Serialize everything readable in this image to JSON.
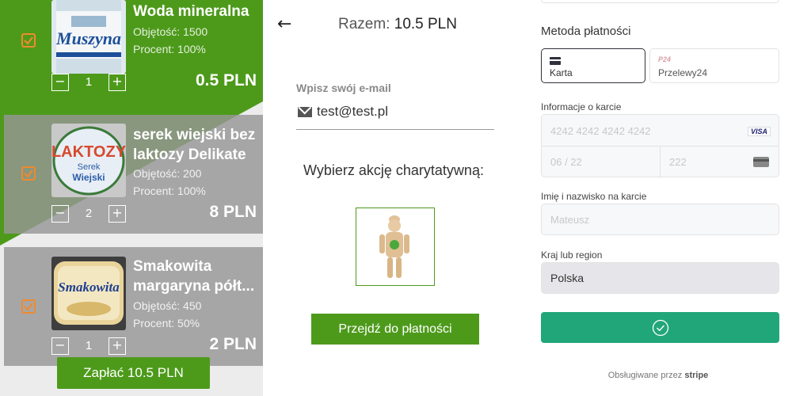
{
  "cart": {
    "items": [
      {
        "name": "Woda mineralna",
        "volume": "Objętość: 1500",
        "percent": "Procent: 100%",
        "qty": "1",
        "price": "0.5 PLN",
        "image": "muszyna-bottle"
      },
      {
        "name": "serek wiejski bez laktozy Delikate",
        "volume": "Objętość: 200",
        "percent": "Procent: 100%",
        "qty": "2",
        "price": "8 PLN",
        "image": "serek-wiejski"
      },
      {
        "name": "Smakowita margaryna półt...",
        "volume": "Objętość: 450",
        "percent": "Procent: 50%",
        "qty": "1",
        "price": "2 PLN",
        "image": "smakowita-margarine"
      }
    ],
    "pay_button": "Zapłać 10.5 PLN",
    "accent": "#4d9a1b",
    "checkbox_color": "#f08a2c"
  },
  "checkout": {
    "total_prefix": "Razem:",
    "total_value": "10.5 PLN",
    "email_label": "Wpisz swój e-mail",
    "email_value": "test@test.pl",
    "charity_label": "Wybierz akcję charytatywną:",
    "proceed_button": "Przejdź do płatności"
  },
  "stripe": {
    "method_label": "Metoda płatności",
    "tabs": [
      "Karta",
      "Przelewy24"
    ],
    "p24_mark": "P24",
    "card_info_label": "Informacje o karcie",
    "card_number_placeholder": "4242 4242 4242 4242",
    "visa": "VISA",
    "expiry_placeholder": "06 / 22",
    "cvc_placeholder": "222",
    "name_label": "Imię i nazwisko na karcie",
    "name_placeholder": "Mateusz",
    "country_label": "Kraj lub region",
    "country_value": "Polska",
    "powered_prefix": "Obsługiwane przez",
    "powered_brand": "stripe",
    "pay_color": "#21a67a"
  }
}
